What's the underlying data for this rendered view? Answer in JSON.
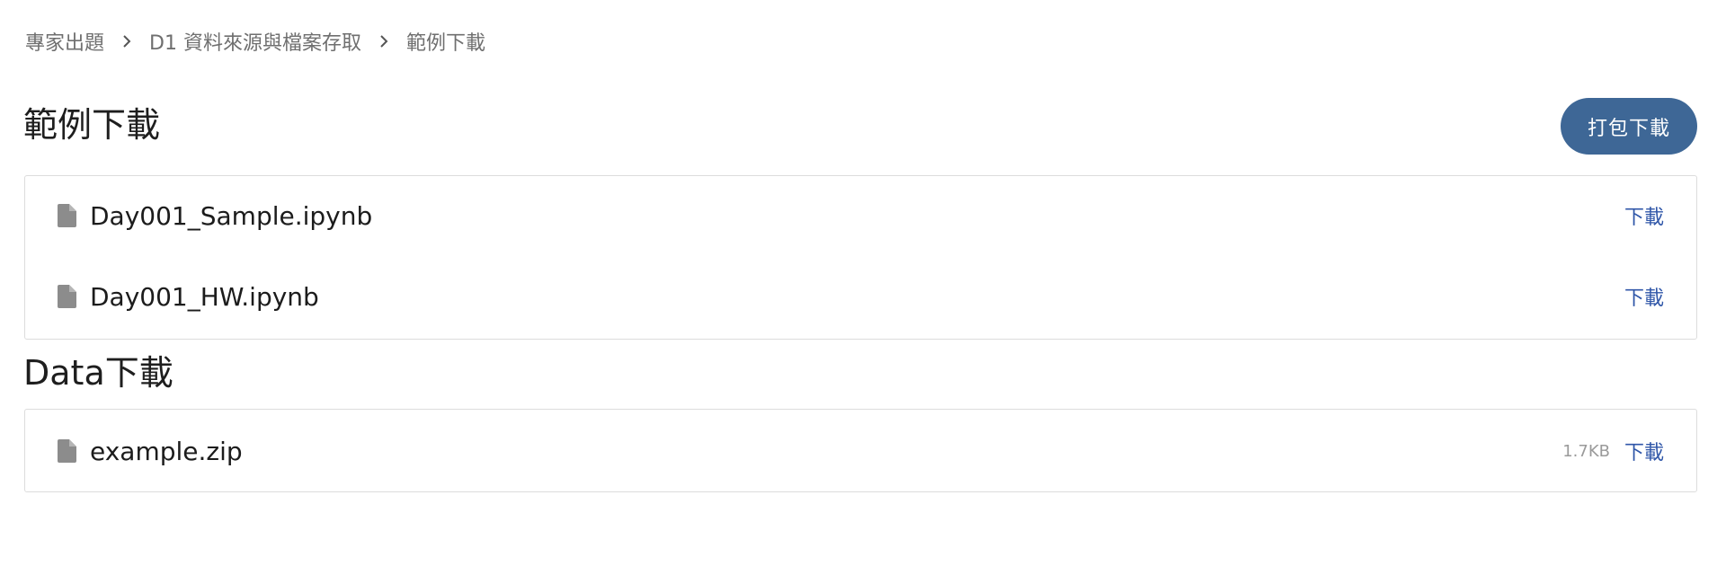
{
  "breadcrumb": {
    "items": [
      "專家出題",
      "D1 資料來源與檔案存取",
      "範例下載"
    ]
  },
  "samples_section": {
    "title": "範例下載",
    "pack_button_label": "打包下載",
    "files": [
      {
        "name": "Day001_Sample.ipynb",
        "download_label": "下載"
      },
      {
        "name": "Day001_HW.ipynb",
        "download_label": "下載"
      }
    ]
  },
  "data_section": {
    "title": "Data下載",
    "files": [
      {
        "name": "example.zip",
        "size": "1.7KB",
        "download_label": "下載"
      }
    ]
  },
  "icons": {
    "file": "file-icon",
    "separator": "chevron-right-icon"
  },
  "colors": {
    "accent_button": "#3e6796",
    "link": "#2f56a8",
    "muted_text": "#6f6f6f"
  }
}
